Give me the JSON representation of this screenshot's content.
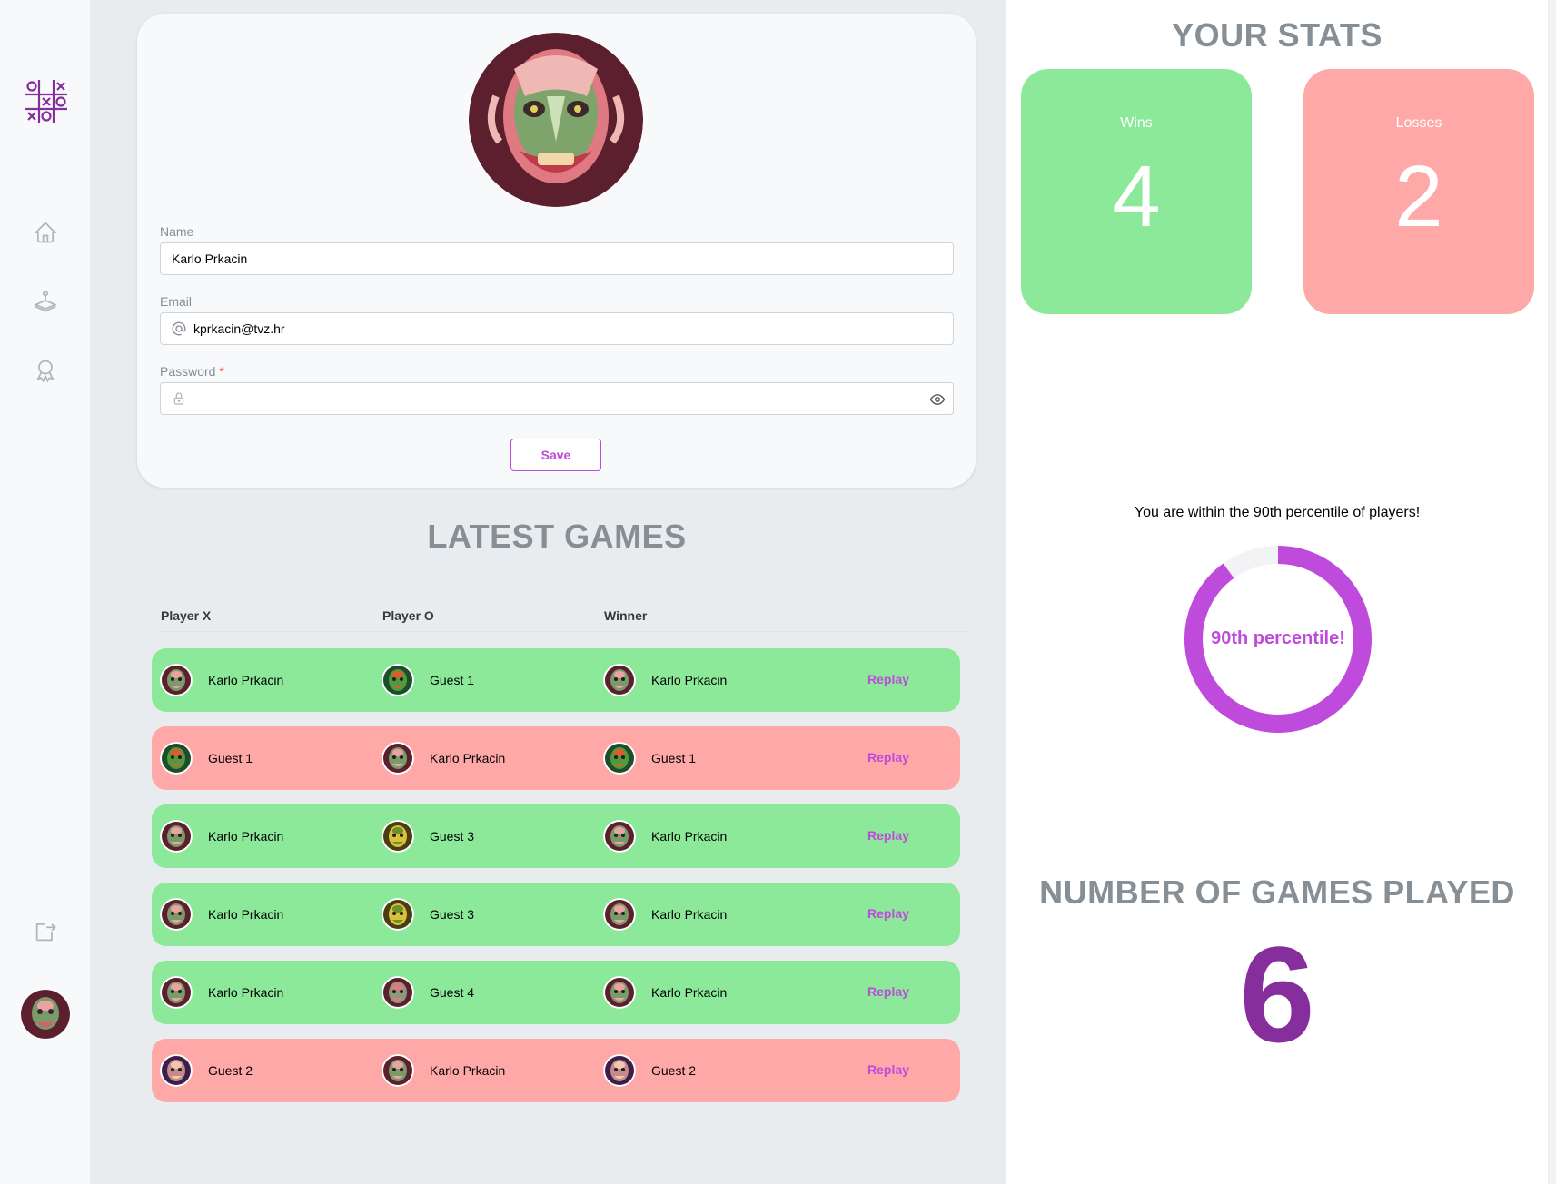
{
  "colors": {
    "accent": "#be4bdb",
    "accent_dark": "#862e9c",
    "win_green": "#8ce99a",
    "loss_red": "#ffa8a8",
    "title_gray": "#868e96"
  },
  "sidebar": {
    "logo": "tic-tac-toe-logo",
    "items": [
      {
        "icon": "home-icon"
      },
      {
        "icon": "joystick-icon"
      },
      {
        "icon": "award-icon"
      }
    ],
    "logout_icon": "logout-icon",
    "avatar": "mask-avatar"
  },
  "profile": {
    "name_label": "Name",
    "name_value": "Karlo Prkacin",
    "email_label": "Email",
    "email_value": "kprkacin@tvz.hr",
    "password_label": "Password",
    "password_required": "*",
    "password_value": "",
    "save_label": "Save"
  },
  "latest_games": {
    "title": "LATEST GAMES",
    "columns": [
      "Player X",
      "Player O",
      "Winner"
    ],
    "replay_label": "Replay",
    "rows": [
      {
        "result": "win",
        "player_x": "Karlo Prkacin",
        "player_o": "Guest 1",
        "winner": "Karlo Prkacin"
      },
      {
        "result": "loss",
        "player_x": "Guest 1",
        "player_o": "Karlo Prkacin",
        "winner": "Guest 1"
      },
      {
        "result": "win",
        "player_x": "Karlo Prkacin",
        "player_o": "Guest 3",
        "winner": "Karlo Prkacin"
      },
      {
        "result": "win",
        "player_x": "Karlo Prkacin",
        "player_o": "Guest 3",
        "winner": "Karlo Prkacin"
      },
      {
        "result": "win",
        "player_x": "Karlo Prkacin",
        "player_o": "Guest 4",
        "winner": "Karlo Prkacin"
      },
      {
        "result": "loss",
        "player_x": "Guest 2",
        "player_o": "Karlo Prkacin",
        "winner": "Guest 2"
      }
    ]
  },
  "stats": {
    "title": "YOUR STATS",
    "wins_label": "Wins",
    "wins_value": "4",
    "losses_label": "Losses",
    "losses_value": "2",
    "percentile_text": "You are within the 90th percentile of players!",
    "percentile_label": "90th percentile!",
    "percentile_value": 90,
    "games_played_title": "NUMBER OF GAMES PLAYED",
    "games_played_value": "6"
  }
}
